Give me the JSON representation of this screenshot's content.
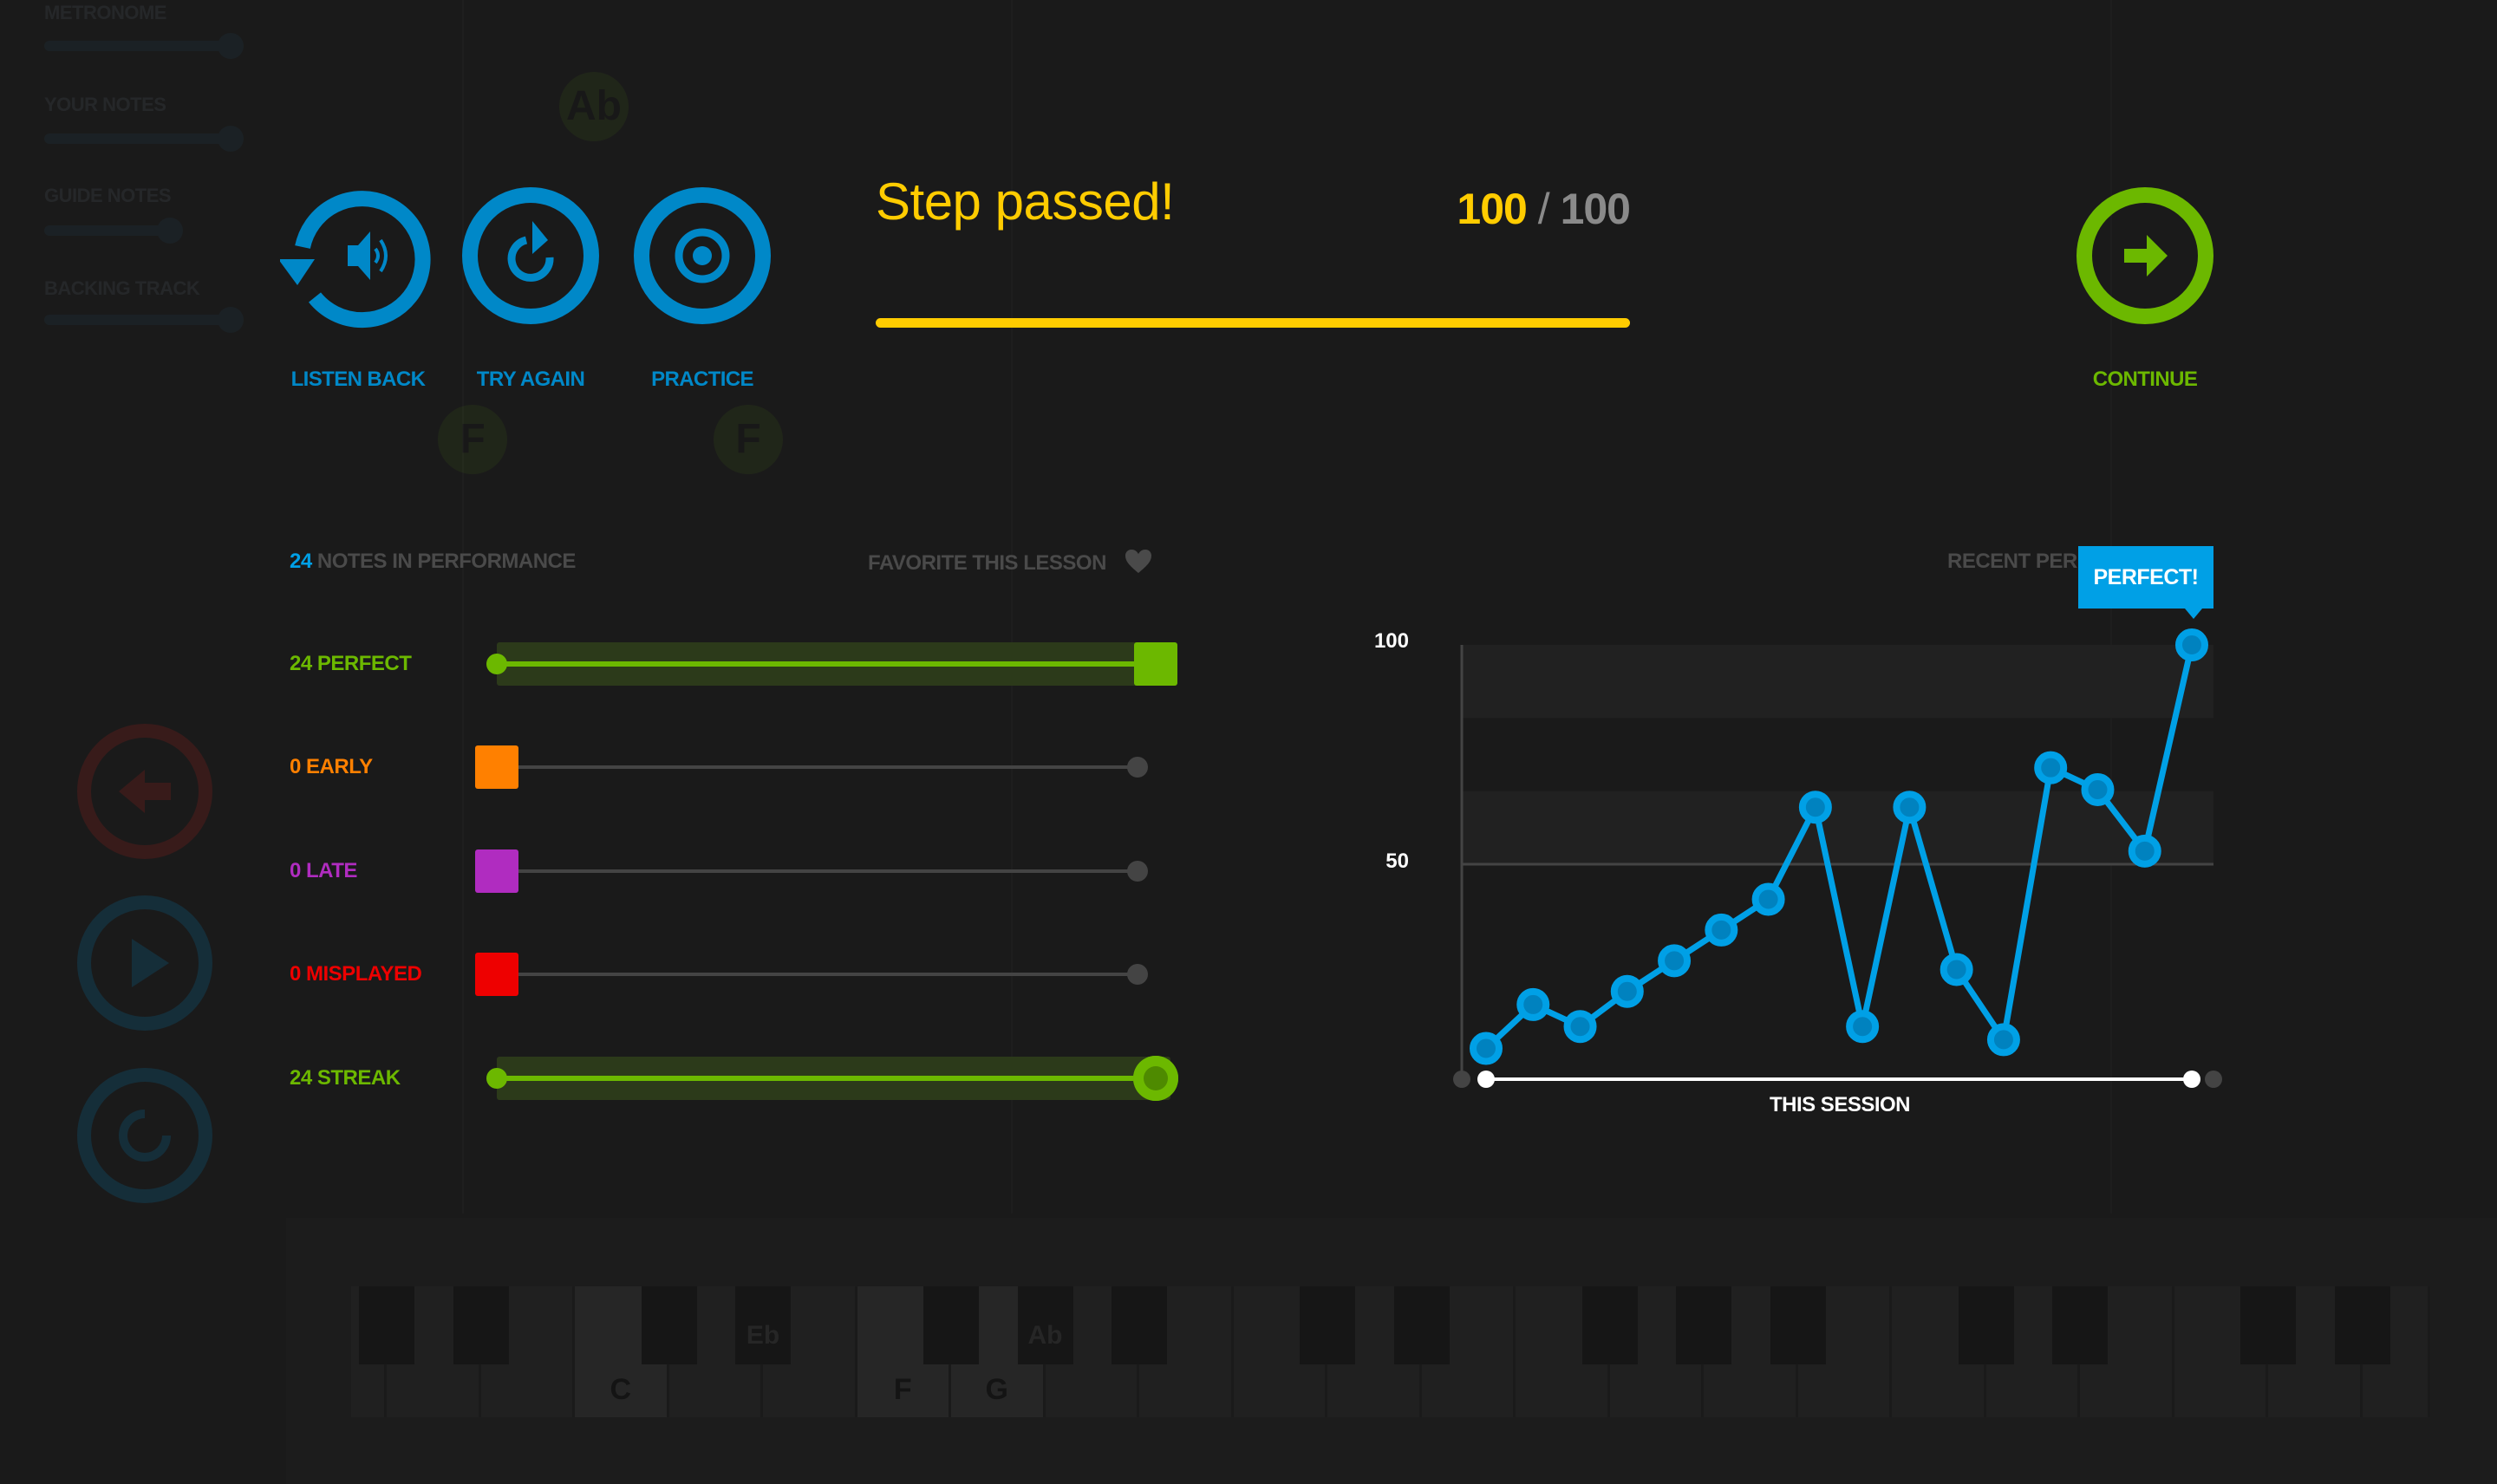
{
  "sidebar": {
    "sliders": [
      {
        "label": "METRONOME",
        "level": 1.0
      },
      {
        "label": "YOUR NOTES",
        "level": 1.0
      },
      {
        "label": "GUIDE NOTES",
        "level": 0.7
      },
      {
        "label": "BACKING TRACK",
        "level": 1.0
      }
    ],
    "buttons": [
      {
        "icon": "back-arrow-icon",
        "color": "#c0201e"
      },
      {
        "icon": "play-icon",
        "color": "#0088c8"
      },
      {
        "icon": "replay-icon",
        "color": "#0088c8"
      }
    ]
  },
  "note_bubbles": [
    "Ab",
    "F",
    "F"
  ],
  "actions": {
    "listen_back": {
      "label": "LISTEN BACK",
      "icon": "listen-back-icon"
    },
    "try_again": {
      "label": "TRY AGAIN",
      "icon": "try-again-icon"
    },
    "practice": {
      "label": "PRACTICE",
      "icon": "practice-target-icon"
    },
    "continue": {
      "label": "CONTINUE",
      "icon": "arrow-right-icon"
    }
  },
  "result": {
    "title": "Step passed!",
    "score": "100",
    "separator": "/",
    "max_score": "100",
    "progress_percent": 100
  },
  "stats": {
    "notes_count": "24",
    "notes_label": "NOTES IN PERFORMANCE",
    "favorite_label": "FAVORITE THIS LESSON",
    "rows": [
      {
        "label": "24 PERFECT",
        "value": 24,
        "max": 24,
        "color": "#6cb800"
      },
      {
        "label": "0 EARLY",
        "value": 0,
        "max": 24,
        "color": "#ff8000"
      },
      {
        "label": "0 LATE",
        "value": 0,
        "max": 24,
        "color": "#b02cc0"
      },
      {
        "label": "0 MISPLAYED",
        "value": 0,
        "max": 24,
        "color": "#ee0000"
      },
      {
        "label": "24 STREAK",
        "value": 24,
        "max": 24,
        "color": "#6cb800"
      }
    ]
  },
  "chart_data": {
    "type": "line",
    "title": "RECENT PERF",
    "xlabel": "THIS SESSION",
    "ylabel": "",
    "ylim": [
      0,
      100
    ],
    "yticks": [
      "100",
      "50"
    ],
    "color": "#00a0e6",
    "values": [
      8,
      18,
      13,
      21,
      28,
      35,
      42,
      63,
      13,
      63,
      26,
      10,
      72,
      67,
      53,
      100
    ],
    "annotation": "PERFECT!"
  },
  "keyboard": {
    "labels": {
      "white": [
        "C",
        "F",
        "G"
      ],
      "black": [
        "Eb",
        "Ab"
      ]
    }
  }
}
